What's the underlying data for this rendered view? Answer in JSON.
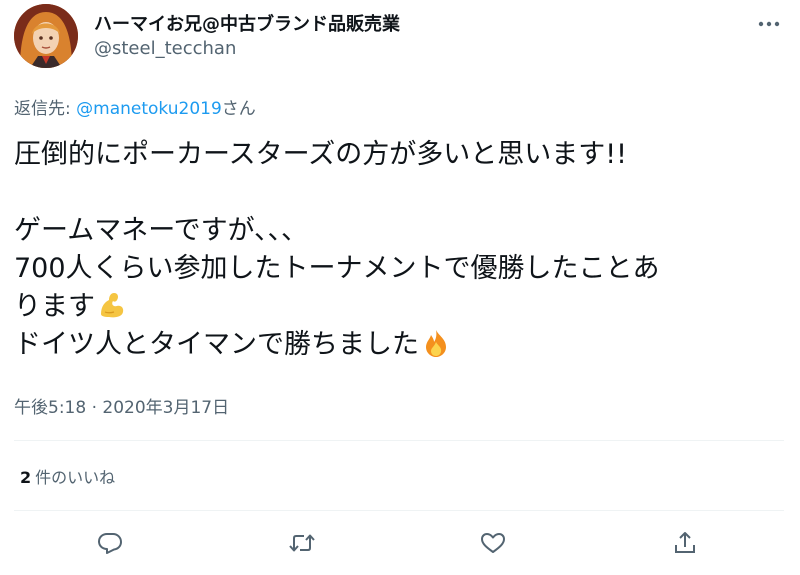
{
  "author": {
    "display_name": "ハーマイお兄@中古ブランド品販売業",
    "handle": "@steel_tecchan",
    "avatar_icon": "avatar-illustration"
  },
  "reply_to": {
    "prefix": "返信先: ",
    "mention": "@manetoku2019",
    "suffix": "さん"
  },
  "body": {
    "line1": "圧倒的にポーカースターズの方が多いと思います!!",
    "line2": "ゲームマネーですが、、、",
    "line3": "700人くらい参加したトーナメントで優勝したことあ",
    "line4": "ります",
    "line5": "ドイツ人とタイマンで勝ちました",
    "emoji1": "flexed-biceps-emoji",
    "emoji2": "fire-emoji"
  },
  "timestamp": "午後5:18 · 2020年3月17日",
  "likes": {
    "count": "2",
    "label": "件のいいね"
  },
  "actions": {
    "reply_icon": "reply-icon",
    "retweet_icon": "retweet-icon",
    "like_icon": "heart-icon",
    "share_icon": "share-icon",
    "more_icon": "more-icon"
  },
  "colors": {
    "text": "#0f1419",
    "secondary": "#536471",
    "link": "#1d9bf0",
    "divider": "#eff3f4"
  }
}
